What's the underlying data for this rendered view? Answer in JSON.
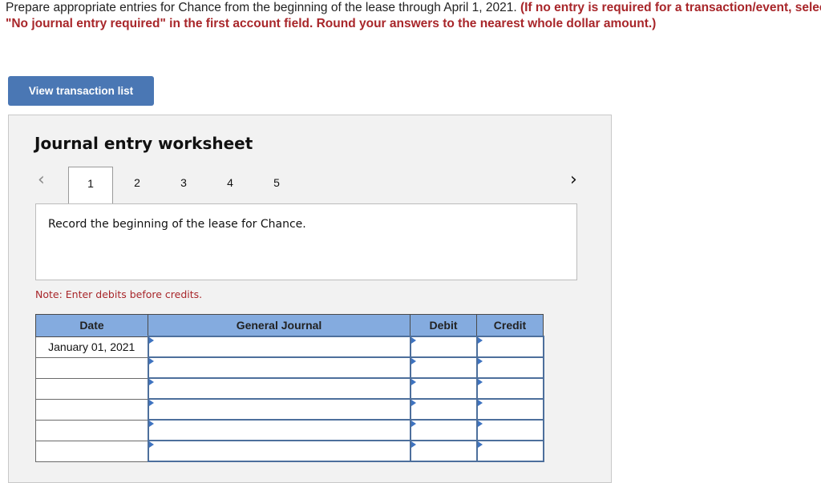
{
  "instructions": {
    "normal": "Prepare appropriate entries for Chance from the beginning of the lease through April 1, 2021. ",
    "bold_red": "(If no entry is required for a transaction/event, select \"No journal entry required\" in the first account field. Round your answers to the nearest whole dollar amount.)"
  },
  "view_transaction_button": "View transaction list",
  "worksheet": {
    "title": "Journal entry worksheet",
    "nav": {
      "prev_icon": "chevron-left",
      "next_icon": "chevron-right"
    },
    "tabs": [
      "1",
      "2",
      "3",
      "4",
      "5"
    ],
    "active_tab": "1",
    "description": "Record the beginning of the lease for Chance.",
    "note": "Note: Enter debits before credits.",
    "table": {
      "headers": [
        "Date",
        "General Journal",
        "Debit",
        "Credit"
      ],
      "rows": [
        {
          "date": "January 01, 2021",
          "account": "",
          "debit": "",
          "credit": ""
        },
        {
          "date": "",
          "account": "",
          "debit": "",
          "credit": ""
        },
        {
          "date": "",
          "account": "",
          "debit": "",
          "credit": ""
        },
        {
          "date": "",
          "account": "",
          "debit": "",
          "credit": ""
        },
        {
          "date": "",
          "account": "",
          "debit": "",
          "credit": ""
        },
        {
          "date": "",
          "account": "",
          "debit": "",
          "credit": ""
        }
      ]
    }
  }
}
